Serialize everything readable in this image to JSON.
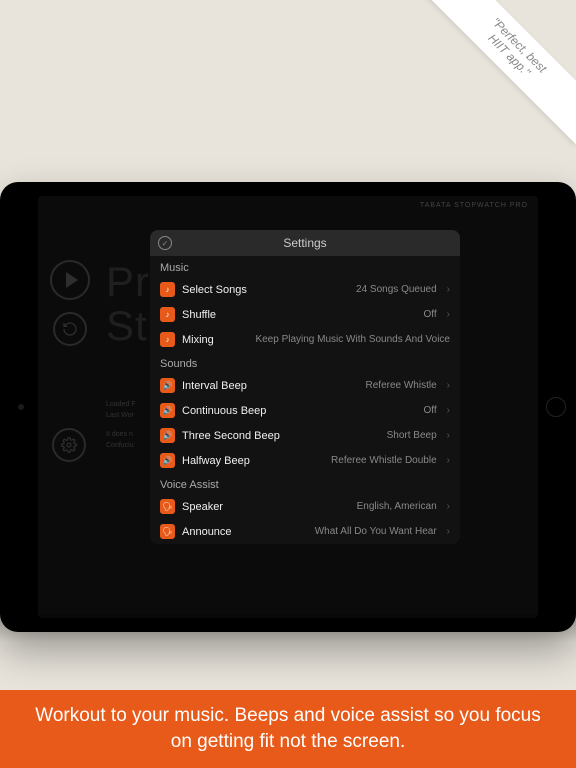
{
  "ribbon": {
    "line1": "\"Perfect, best",
    "line2": "HIIT app.\""
  },
  "appHeader": "TABATA STOPWATCH PRO",
  "bg": {
    "line1": "Pr",
    "line2": "St"
  },
  "sub1": {
    "a": "Loaded F",
    "b": "Last Wor"
  },
  "sub2": {
    "a": "It does n",
    "b": "Confuciu"
  },
  "panel": {
    "title": "Settings",
    "sections": [
      {
        "header": "Music",
        "rows": [
          {
            "icon": "♪",
            "label": "Select Songs",
            "value": "24 Songs Queued",
            "chev": true
          },
          {
            "icon": "♪",
            "label": "Shuffle",
            "value": "Off",
            "chev": true
          },
          {
            "icon": "♪",
            "label": "Mixing",
            "value": "Keep Playing Music With Sounds And Voice",
            "chev": false
          }
        ]
      },
      {
        "header": "Sounds",
        "rows": [
          {
            "icon": "🔊",
            "label": "Interval Beep",
            "value": "Referee Whistle",
            "chev": true
          },
          {
            "icon": "🔊",
            "label": "Continuous Beep",
            "value": "Off",
            "chev": true
          },
          {
            "icon": "🔊",
            "label": "Three Second Beep",
            "value": "Short Beep",
            "chev": true
          },
          {
            "icon": "🔊",
            "label": "Halfway Beep",
            "value": "Referee Whistle Double",
            "chev": true
          }
        ]
      },
      {
        "header": "Voice Assist",
        "rows": [
          {
            "icon": "🗣",
            "label": "Speaker",
            "value": "English, American",
            "chev": true
          },
          {
            "icon": "🗣",
            "label": "Announce",
            "value": "What All Do You Want Hear",
            "chev": true
          }
        ]
      }
    ]
  },
  "caption": "Workout to your music. Beeps and voice assist so you focus on getting fit not the screen."
}
